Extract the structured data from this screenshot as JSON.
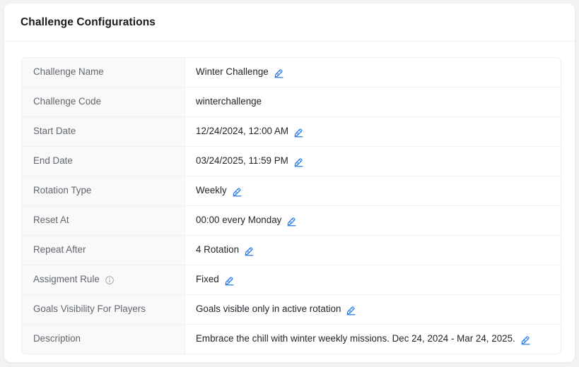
{
  "card": {
    "title": "Challenge Configurations"
  },
  "icons": {
    "edit": "edit-pencil-icon",
    "info": "info-circle-icon"
  },
  "colors": {
    "page_background": "#f1f2f4",
    "card_background": "#ffffff",
    "card_border": "#eceef0",
    "label_cell_background": "#f9f9fa",
    "label_text": "#61676e",
    "value_text": "#1f2328",
    "title_text": "#17191c",
    "edit_icon_blue": "#1a73e8",
    "info_icon_gray": "#9aa0a6",
    "row_divider": "#eff0f2"
  },
  "config_rows": [
    {
      "label": "Challenge Name",
      "value": "Winter Challenge",
      "editable": true,
      "has_info": false
    },
    {
      "label": "Challenge Code",
      "value": "winterchallenge",
      "editable": false,
      "has_info": false
    },
    {
      "label": "Start Date",
      "value": "12/24/2024, 12:00 AM",
      "editable": true,
      "has_info": false
    },
    {
      "label": "End Date",
      "value": "03/24/2025, 11:59 PM",
      "editable": true,
      "has_info": false
    },
    {
      "label": "Rotation Type",
      "value": "Weekly",
      "editable": true,
      "has_info": false
    },
    {
      "label": "Reset At",
      "value": "00:00 every Monday",
      "editable": true,
      "has_info": false
    },
    {
      "label": "Repeat After",
      "value": "4 Rotation",
      "editable": true,
      "has_info": false
    },
    {
      "label": "Assigment Rule",
      "value": "Fixed",
      "editable": true,
      "has_info": true
    },
    {
      "label": "Goals Visibility For Players",
      "value": "Goals visible only in active rotation",
      "editable": true,
      "has_info": false
    },
    {
      "label": "Description",
      "value": "Embrace the chill with winter weekly missions. Dec 24, 2024 - Mar 24, 2025.",
      "editable": true,
      "has_info": false
    }
  ]
}
